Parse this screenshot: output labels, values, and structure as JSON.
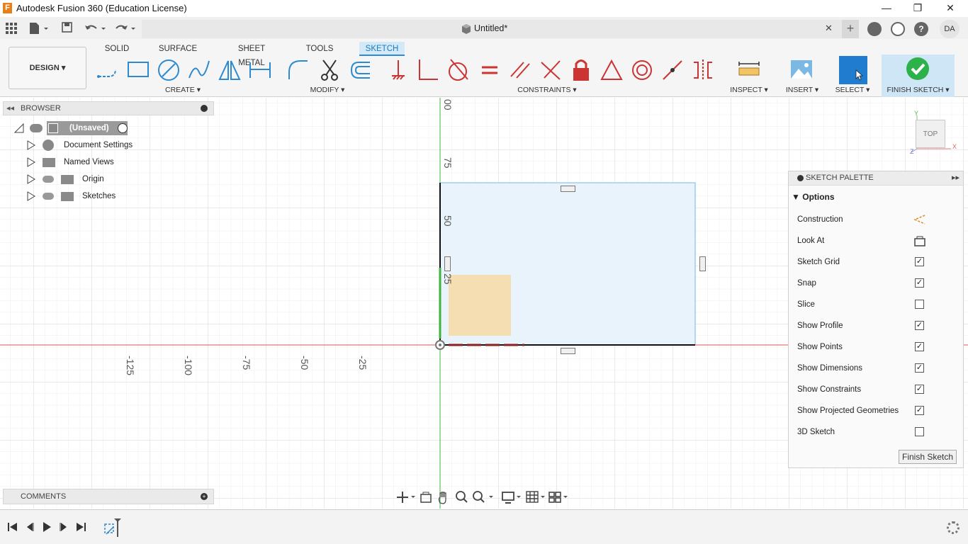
{
  "window": {
    "app_title": "Autodesk Fusion 360 (Education License)",
    "logo_letter": "F",
    "minimize": "—",
    "maximize": "❐",
    "close": "✕"
  },
  "appbar": {
    "doc_title": "Untitled*",
    "close_tab": "✕",
    "user_initials": "DA"
  },
  "ribbon": {
    "workspace": "DESIGN ▾",
    "tabs": [
      "SOLID",
      "SURFACE",
      "SHEET METAL",
      "TOOLS",
      "SKETCH"
    ],
    "active_tab": "SKETCH",
    "groups": {
      "create": "CREATE ▾",
      "modify": "MODIFY ▾",
      "constraints": "CONSTRAINTS ▾",
      "inspect": "INSPECT ▾",
      "insert": "INSERT ▾",
      "select": "SELECT ▾",
      "finish": "FINISH SKETCH ▾"
    }
  },
  "browser": {
    "title": "BROWSER",
    "root": "(Unsaved)",
    "items": [
      "Document Settings",
      "Named Views",
      "Origin",
      "Sketches"
    ]
  },
  "comments": {
    "title": "COMMENTS"
  },
  "viewcube": {
    "face": "TOP",
    "axis_x": "X",
    "axis_y": "Y",
    "axis_z": "Z"
  },
  "canvas": {
    "x_ticks": [
      "-125",
      "-100",
      "-75",
      "-50",
      "-25"
    ],
    "y_ticks": [
      "00",
      "75",
      "50",
      "25"
    ]
  },
  "palette": {
    "title": "SKETCH PALETTE",
    "section": "Options",
    "rows": [
      {
        "label": "Construction",
        "kind": "icon",
        "icon": "construction-icon"
      },
      {
        "label": "Look At",
        "kind": "icon",
        "icon": "look-at-icon"
      },
      {
        "label": "Sketch Grid",
        "kind": "check",
        "checked": true
      },
      {
        "label": "Snap",
        "kind": "check",
        "checked": true
      },
      {
        "label": "Slice",
        "kind": "check",
        "checked": false
      },
      {
        "label": "Show Profile",
        "kind": "check",
        "checked": true
      },
      {
        "label": "Show Points",
        "kind": "check",
        "checked": true
      },
      {
        "label": "Show Dimensions",
        "kind": "check",
        "checked": true
      },
      {
        "label": "Show Constraints",
        "kind": "check",
        "checked": true
      },
      {
        "label": "Show Projected Geometries",
        "kind": "check",
        "checked": true
      },
      {
        "label": "3D Sketch",
        "kind": "check",
        "checked": false
      }
    ],
    "finish_button": "Finish Sketch"
  },
  "colors": {
    "accent": "#2e8bd3",
    "finish_green": "#2db24a",
    "profile_fill": "#e8f3fb",
    "profile_stroke": "#7ab8e0",
    "selected_fill": "#f5dcaa",
    "x_axis": "#e05050",
    "y_axis": "#3cb43c"
  }
}
